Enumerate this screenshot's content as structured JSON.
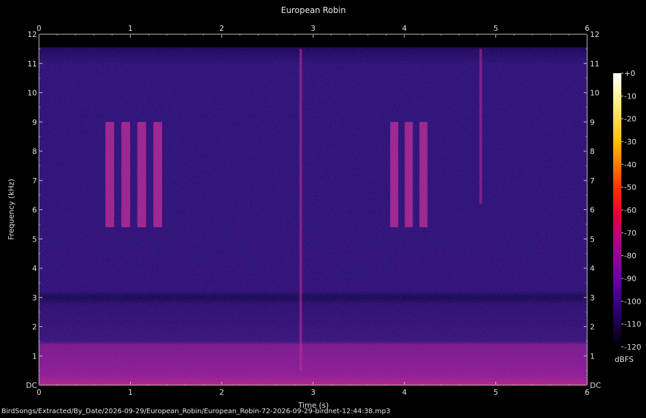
{
  "file_path": "BirdSongs/Extracted/By_Date/2026-09-29/European_Robin/European_Robin-72-2026-09-29-birdnet-12:44:38.mp3",
  "chart_data": {
    "type": "heatmap",
    "title": "European Robin",
    "xlabel": "Time (s)",
    "ylabel": "Frequency (kHz)",
    "xlim": [
      0,
      6
    ],
    "ylim": [
      0,
      12
    ],
    "x_ticks": [
      "0",
      "1",
      "2",
      "3",
      "4",
      "5",
      "6"
    ],
    "y_ticks": [
      "DC",
      "1",
      "2",
      "3",
      "4",
      "5",
      "6",
      "7",
      "8",
      "9",
      "10",
      "11",
      "12"
    ],
    "colorbar": {
      "label": "dBFS",
      "range": [
        -120,
        0
      ],
      "ticks": [
        "+0",
        "-10",
        "-20",
        "-30",
        "-40",
        "-50",
        "-60",
        "-70",
        "-80",
        "-90",
        "-100",
        "-110",
        "-120"
      ]
    },
    "colors": {
      "background": "#000000",
      "noise_floor": "#2a1270",
      "low_band": "#9a1f9a",
      "song": "#c0309a"
    },
    "features": [
      {
        "t_start": 0.7,
        "t_end": 1.4,
        "f_low": 5.4,
        "f_high": 9.0,
        "level_db": -75
      },
      {
        "t_start": 3.82,
        "t_end": 4.3,
        "f_low": 5.4,
        "f_high": 9.0,
        "level_db": -75
      },
      {
        "t_start": 2.85,
        "t_end": 2.88,
        "f_low": 0.5,
        "f_high": 11.5,
        "level_db": -88
      },
      {
        "t_start": 4.82,
        "t_end": 4.85,
        "f_low": 6.2,
        "f_high": 11.5,
        "level_db": -90
      }
    ]
  }
}
